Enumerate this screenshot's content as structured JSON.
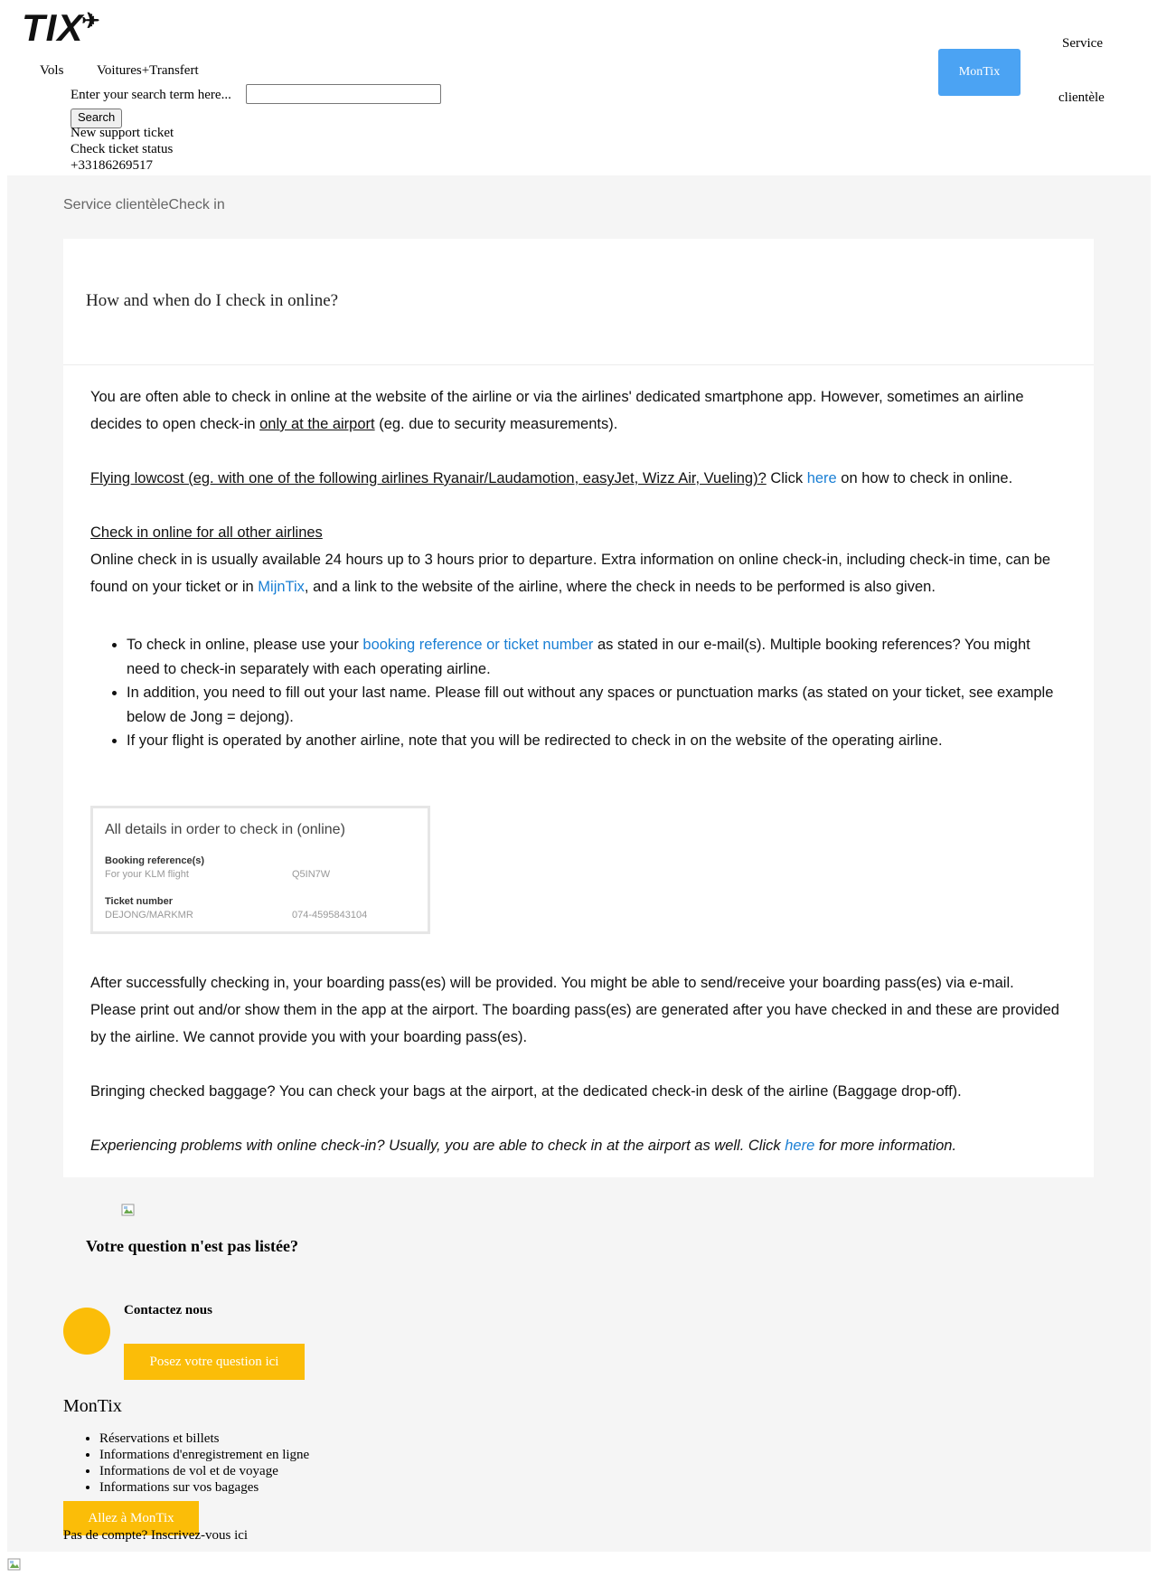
{
  "header": {
    "logo_text": "TIX",
    "logo_plane": "✈",
    "nav": {
      "vols": "Vols",
      "cars": "Voitures+Transfert"
    },
    "search": {
      "label": "Enter your search term here...",
      "button": "Search",
      "value": "",
      "placeholder": ""
    },
    "links": [
      "New support ticket",
      "Check ticket status",
      "+33186269517"
    ],
    "montix_button": "MonTix",
    "service_line1": "Service",
    "service_line2": "clientèle"
  },
  "breadcrumb": {
    "part1": "Service clientèle",
    "part2": "Check in"
  },
  "article": {
    "title": "How and when do I check in online?",
    "p1_a": "You are often able to check in online at the website of the airline or via the airlines' dedicated smartphone app. However, sometimes an airline decides to open check-in ",
    "p1_link": "only at the airport",
    "p1_b": " (eg. due to security measurements).",
    "p2_u": "Flying lowcost (eg. with one of the following airlines Ryanair/Laudamotion, easyJet, Wizz Air, Vueling)?",
    "p2_click": " Click ",
    "p2_link": "here",
    "p2_b": " on how to check in online.",
    "p3_heading": "Check in online for all other airlines",
    "p3_a": "Online check in is usually available 24 hours up to 3 hours prior to departure. Extra information on online check-in, including check-in time, can be found on your ticket or in ",
    "p3_link": "MijnTix",
    "p3_b": ", and a link to the website of the airline, where the check in needs to be performed is also given.",
    "li1_a": "To check in online, please use your ",
    "li1_link": "booking reference or ticket number",
    "li1_b": " as stated in our e-mail(s). Multiple booking references? You might need to check-in separately with each operating airline.",
    "li2": "In addition, you need to fill out your last name. Please fill out without any spaces or punctuation marks (as stated on your ticket, see example below de Jong = dejong).",
    "li3": "If your flight is operated by another airline, note that you will be redirected to check in on the website of the operating airline.",
    "p4": "After successfully checking in, your boarding pass(es) will be provided. You might be able to send/receive your boarding pass(es) via e-mail. Please print out and/or show them in the app at the airport. The boarding pass(es) are generated after you have checked in and these are provided by the airline. We cannot provide you with your boarding pass(es).",
    "p5": "Bringing checked baggage? You can check your bags at the airport, at the dedicated check-in desk of the airline (Baggage drop-off).",
    "p6_a": "Experiencing problems with online check-in? Usually, you are able to check in at the airport as well. Click ",
    "p6_link": "here",
    "p6_b": " for more information."
  },
  "details_box": {
    "title": "All details in order to check in (online)",
    "booking_label": "Booking reference(s)",
    "booking_sub": "For your KLM flight",
    "booking_value": "Q5IN7W",
    "ticket_label": "Ticket number",
    "ticket_sub": "DEJONG/MARKMR",
    "ticket_value": "074-4595843104"
  },
  "bottom": {
    "question_title": "Votre question n'est pas listée?",
    "contact": "Contactez nous",
    "ask_button": "Posez votre question ici",
    "montix_heading": "MonTix",
    "montix_items": [
      "Réservations et billets",
      "Informations d'enregistrement en ligne",
      "Informations de vol et de voyage",
      "Informations sur vos bagages"
    ],
    "goto_button": "Allez à MonTix",
    "no_account": "Pas de compte? Inscrivez-vous ici"
  },
  "colors": {
    "accent_blue": "#4ba3f3",
    "link_blue": "#1a7fd4",
    "accent_yellow": "#fbbd08",
    "gray_bg": "#f5f5f5"
  }
}
